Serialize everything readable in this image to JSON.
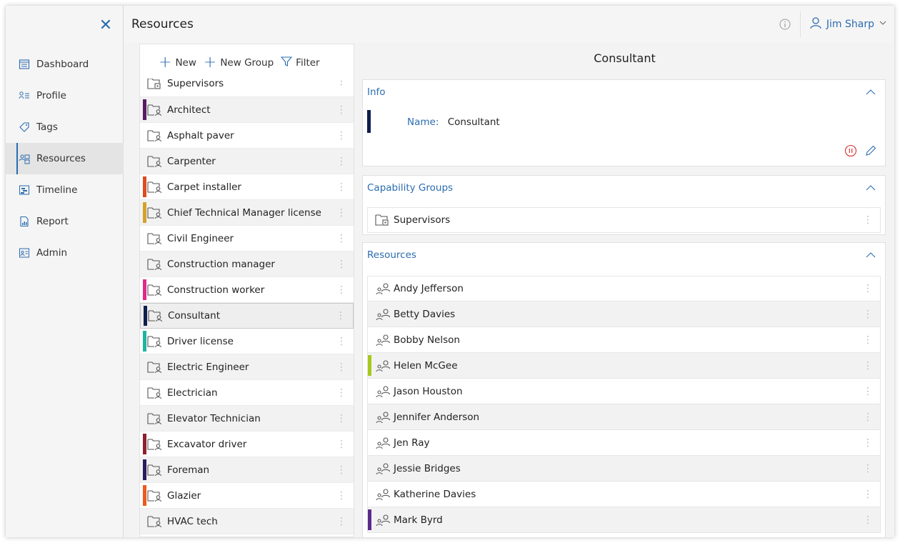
{
  "nav": {
    "items": [
      {
        "label": "Dashboard",
        "icon": "dashboard-icon"
      },
      {
        "label": "Profile",
        "icon": "profile-icon"
      },
      {
        "label": "Tags",
        "icon": "tag-icon"
      },
      {
        "label": "Resources",
        "icon": "resources-icon",
        "active": true
      },
      {
        "label": "Timeline",
        "icon": "timeline-icon"
      },
      {
        "label": "Report",
        "icon": "report-icon"
      },
      {
        "label": "Admin",
        "icon": "admin-icon"
      }
    ]
  },
  "header": {
    "title": "Resources",
    "user": "Jim Sharp"
  },
  "toolbar": {
    "new_label": "New",
    "new_group_label": "New Group",
    "filter_label": "Filter"
  },
  "list": {
    "items": [
      {
        "label": "Supervisors",
        "stripe": null,
        "group": true
      },
      {
        "label": "Architect",
        "stripe": "#5b1a66"
      },
      {
        "label": "Asphalt paver",
        "stripe": null
      },
      {
        "label": "Carpenter",
        "stripe": null
      },
      {
        "label": "Carpet installer",
        "stripe": "#e04a1f"
      },
      {
        "label": "Chief Technical Manager license",
        "stripe": "#d6a12a"
      },
      {
        "label": "Civil Engineer",
        "stripe": null
      },
      {
        "label": "Construction manager",
        "stripe": null
      },
      {
        "label": "Construction worker",
        "stripe": "#e0298a"
      },
      {
        "label": "Consultant",
        "stripe": "#0e1f4d",
        "selected": true
      },
      {
        "label": "Driver license",
        "stripe": "#1fb5a0"
      },
      {
        "label": "Electric Engineer",
        "stripe": null
      },
      {
        "label": "Electrician",
        "stripe": null
      },
      {
        "label": "Elevator Technician",
        "stripe": null
      },
      {
        "label": "Excavator driver",
        "stripe": "#8f1f2d"
      },
      {
        "label": "Foreman",
        "stripe": "#2a1a5e"
      },
      {
        "label": "Glazier",
        "stripe": "#ec5a1c"
      },
      {
        "label": "HVAC tech",
        "stripe": null
      }
    ]
  },
  "detail": {
    "title": "Consultant",
    "info": {
      "heading": "Info",
      "name_key": "Name:",
      "name_value": "Consultant",
      "stripe": "#0e1f4d"
    },
    "capability_groups": {
      "heading": "Capability Groups",
      "items": [
        "Supervisors"
      ]
    },
    "resources": {
      "heading": "Resources",
      "items": [
        {
          "label": "Andy Jefferson",
          "stripe": null
        },
        {
          "label": "Betty Davies",
          "stripe": null
        },
        {
          "label": "Bobby Nelson",
          "stripe": null
        },
        {
          "label": "Helen McGee",
          "stripe": "#a6c91c"
        },
        {
          "label": "Jason Houston",
          "stripe": null
        },
        {
          "label": "Jennifer Anderson",
          "stripe": null
        },
        {
          "label": "Jen Ray",
          "stripe": null
        },
        {
          "label": "Jessie Bridges",
          "stripe": null
        },
        {
          "label": "Katherine Davies",
          "stripe": null
        },
        {
          "label": "Mark Byrd",
          "stripe": "#5b2a8a"
        }
      ]
    }
  },
  "colors": {
    "accent": "#2b6cb0",
    "danger": "#d9302a"
  }
}
